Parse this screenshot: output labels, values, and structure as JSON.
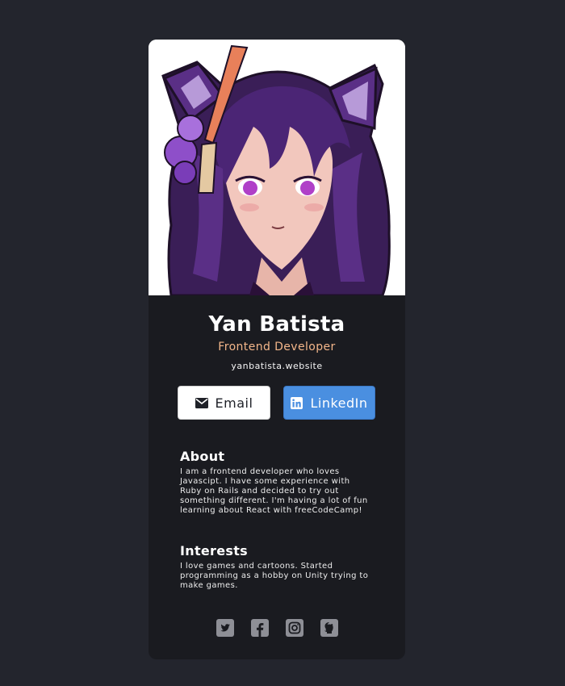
{
  "profile": {
    "name": "Yan Batista",
    "role": "Frontend Developer",
    "website": "yanbatista.website",
    "avatar_icon": "anime-girl-avatar"
  },
  "buttons": {
    "email_label": "Email",
    "linkedin_label": "LinkedIn"
  },
  "about": {
    "heading": "About",
    "text": "I am a frontend developer who loves Javascipt. I have some experience with Ruby on Rails and decided to try out something different. I'm having a lot of fun learning about React with freeCodeCamp!"
  },
  "interests": {
    "heading": "Interests",
    "text": "I love games and cartoons. Started programming as a hobby on Unity trying to make games."
  },
  "social": [
    {
      "icon": "twitter-icon"
    },
    {
      "icon": "facebook-icon"
    },
    {
      "icon": "instagram-icon"
    },
    {
      "icon": "github-icon"
    }
  ],
  "colors": {
    "page_bg": "#23252d",
    "card_bg": "#1a1b20",
    "role_accent": "#f3b68a",
    "linkedin_blue": "#4a8fe0",
    "social_icon": "#8e8f96"
  }
}
